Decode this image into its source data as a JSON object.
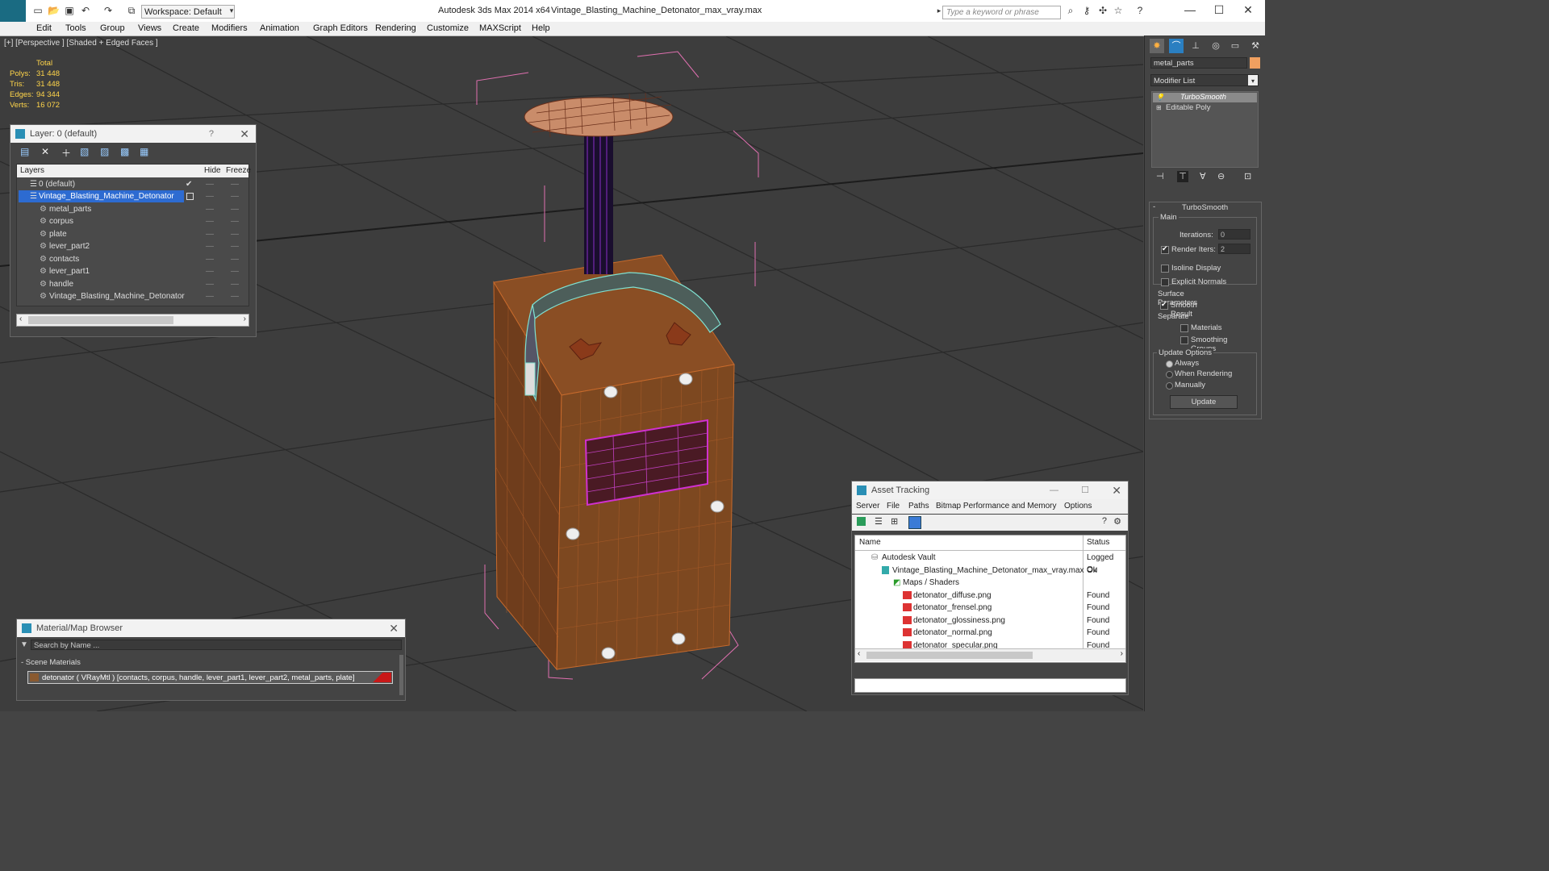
{
  "app": {
    "title": "Autodesk 3ds Max  2014 x64",
    "file": "Vintage_Blasting_Machine_Detonator_max_vray.max",
    "workspace": "Workspace: Default",
    "search_placeholder": "Type a keyword or phrase"
  },
  "menu": [
    "Edit",
    "Tools",
    "Group",
    "Views",
    "Create",
    "Modifiers",
    "Animation",
    "Graph Editors",
    "Rendering",
    "Customize",
    "MAXScript",
    "Help"
  ],
  "viewport": {
    "label": "[+] [Perspective ] [Shaded + Edged Faces ]",
    "stats_header": "Total",
    "stats": [
      {
        "label": "Polys:",
        "value": "31 448"
      },
      {
        "label": "Tris:",
        "value": "31 448"
      },
      {
        "label": "Edges:",
        "value": "94 344"
      },
      {
        "label": "Verts:",
        "value": "16 072"
      }
    ]
  },
  "layer_dialog": {
    "title": "Layer: 0 (default)",
    "help": "?",
    "columns": {
      "layers": "Layers",
      "hide": "Hide",
      "freeze": "Freeze"
    },
    "rows": [
      {
        "name": "0 (default)"
      },
      {
        "name": "Vintage_Blasting_Machine_Detonator"
      },
      {
        "name": "metal_parts"
      },
      {
        "name": "corpus"
      },
      {
        "name": "plate"
      },
      {
        "name": "lever_part2"
      },
      {
        "name": "contacts"
      },
      {
        "name": "lever_part1"
      },
      {
        "name": "handle"
      },
      {
        "name": "Vintage_Blasting_Machine_Detonator"
      }
    ]
  },
  "material_browser": {
    "title": "Material/Map Browser",
    "search_placeholder": "Search by Name ...",
    "group": "- Scene Materials",
    "item": "detonator  ( VRayMtl )  [contacts, corpus, handle, lever_part1, lever_part2, metal_parts, plate]"
  },
  "asset_tracking": {
    "title": "Asset Tracking",
    "menu": [
      "Server",
      "File",
      "Paths",
      "Bitmap Performance and Memory",
      "Options"
    ],
    "columns": {
      "name": "Name",
      "status": "Status"
    },
    "rows": [
      {
        "name": "Autodesk Vault",
        "status": "Logged Ou"
      },
      {
        "name": "Vintage_Blasting_Machine_Detonator_max_vray.max",
        "status": "Ok"
      },
      {
        "name": "Maps / Shaders",
        "status": ""
      },
      {
        "name": "detonator_diffuse.png",
        "status": "Found"
      },
      {
        "name": "detonator_frensel.png",
        "status": "Found"
      },
      {
        "name": "detonator_glossiness.png",
        "status": "Found"
      },
      {
        "name": "detonator_normal.png",
        "status": "Found"
      },
      {
        "name": "detonator_specular.png",
        "status": "Found"
      }
    ]
  },
  "command_panel": {
    "object_name": "metal_parts",
    "modifier_list": "Modifier List",
    "stack": [
      "TurboSmooth",
      "Editable Poly"
    ],
    "rollout_title": "TurboSmooth",
    "main_label": "Main",
    "iterations_label": "Iterations:",
    "iterations_value": "0",
    "render_iters_label": "Render Iters:",
    "render_iters_value": "2",
    "isoline": "Isoline Display",
    "explicit_normals": "Explicit Normals",
    "surface_params": "Surface Parameters",
    "smooth_result": "Smooth Result",
    "separate": "Separate",
    "materials": "Materials",
    "smoothing_groups": "Smoothing Groups",
    "update_options": "Update Options",
    "always": "Always",
    "when_rendering": "When Rendering",
    "manually": "Manually",
    "update_button": "Update"
  },
  "colors": {
    "accent": "#1e73d8",
    "highlight_row": "#2d6bd1",
    "stats": "#ffd54a",
    "object_color": "#f0a060"
  }
}
